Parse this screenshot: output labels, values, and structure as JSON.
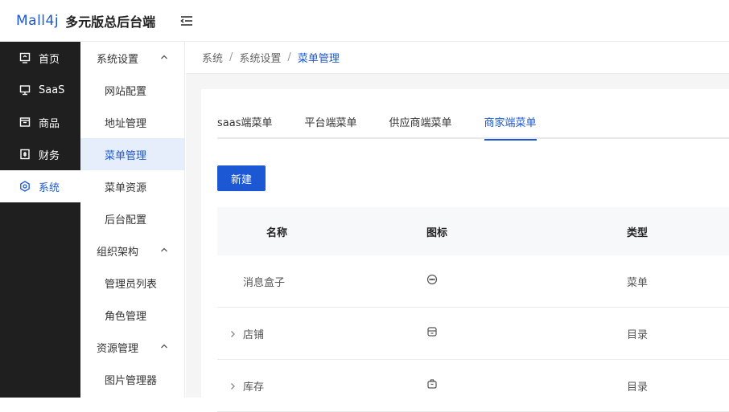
{
  "header": {
    "logo_mark": "Mall4j",
    "title": "多元版总后台端"
  },
  "sidebar_dark": {
    "items": [
      {
        "label": "首页",
        "icon": "monitor-icon"
      },
      {
        "label": "SaaS",
        "icon": "computer-icon"
      },
      {
        "label": "商品",
        "icon": "box-icon"
      },
      {
        "label": "财务",
        "icon": "wallet-icon"
      },
      {
        "label": "系统",
        "icon": "gear-icon",
        "active": true
      }
    ]
  },
  "sidebar_sub": {
    "groups": [
      {
        "title": "系统设置",
        "items": [
          "网站配置",
          "地址管理",
          "菜单管理",
          "菜单资源",
          "后台配置"
        ]
      },
      {
        "title": "组织架构",
        "items": [
          "管理员列表",
          "角色管理"
        ]
      },
      {
        "title": "资源管理",
        "items": [
          "图片管理器"
        ]
      }
    ],
    "active_item": "菜单管理"
  },
  "breadcrumb": {
    "level1": "系统",
    "level2": "系统设置",
    "current": "菜单管理",
    "sep": "/"
  },
  "tabs": [
    "saas端菜单",
    "平台端菜单",
    "供应商端菜单",
    "商家端菜单"
  ],
  "active_tab": "商家端菜单",
  "new_button": "新建",
  "table": {
    "headers": {
      "name": "名称",
      "icon": "图标",
      "type": "类型"
    },
    "rows": [
      {
        "name": "消息盒子",
        "icon": "chat-icon",
        "type": "菜单",
        "expandable": false
      },
      {
        "name": "店铺",
        "icon": "shop-icon",
        "type": "目录",
        "expandable": true
      },
      {
        "name": "库存",
        "icon": "package-icon",
        "type": "目录",
        "expandable": true
      }
    ]
  },
  "colors": {
    "primary": "#1c58d4",
    "sidebar_dark": "#1f1f1f"
  }
}
